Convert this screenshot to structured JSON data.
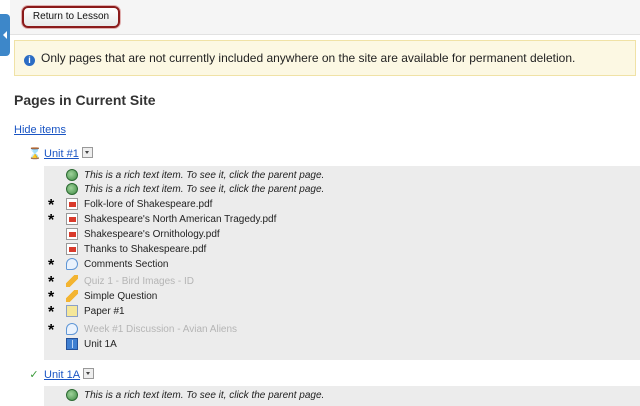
{
  "topbar": {
    "return_label": "Return to Lesson"
  },
  "info": {
    "icon": "info-icon",
    "message": "Only pages that are not currently included anywhere on the site are available for permanent deletion."
  },
  "page": {
    "title": "Pages in Current Site",
    "hide_items": "Hide items"
  },
  "units": [
    {
      "name": "Unit #1",
      "status_icon": "hourglass-icon",
      "status_glyph": "⌛"
    },
    {
      "name": "Unit 1A",
      "status_icon": "checkmark-icon",
      "status_glyph": "✓"
    }
  ],
  "unit1_items": [
    {
      "text": "This is a rich text item. To see it, click the parent page.",
      "icon": "rich-text-icon",
      "star": ""
    },
    {
      "text": "This is a rich text item. To see it, click the parent page.",
      "icon": "rich-text-icon",
      "star": ""
    },
    {
      "text": "Folk-lore of Shakespeare.pdf",
      "icon": "pdf-icon",
      "star": "*"
    },
    {
      "text": "Shakespeare's North American Tragedy.pdf",
      "icon": "pdf-icon",
      "star": "*"
    },
    {
      "text": "Shakespeare's Ornithology.pdf",
      "icon": "pdf-icon",
      "star": ""
    },
    {
      "text": "Thanks to Shakespeare.pdf",
      "icon": "pdf-icon",
      "star": ""
    },
    {
      "text": "Comments Section",
      "icon": "comment-icon",
      "star": "*"
    },
    {
      "text": "Quiz 1 - Bird Images - ID",
      "icon": "pencil-icon",
      "star": "*"
    },
    {
      "text": "Simple Question",
      "icon": "pencil-icon",
      "star": "*"
    },
    {
      "text": "Paper #1",
      "icon": "paper-icon",
      "star": "*"
    },
    {
      "text": "Week #1 Discussion - Avian Aliens",
      "icon": "comment-icon",
      "star": "*"
    },
    {
      "text": "Unit 1A",
      "icon": "book-icon",
      "star": ""
    }
  ],
  "unit2_items": [
    {
      "text": "This is a rich text item. To see it, click the parent page.",
      "icon": "rich-text-icon",
      "star": ""
    }
  ],
  "colors": {
    "link": "#1a55c4",
    "info_bg": "#fcf8e3",
    "panel_bg": "#ececec",
    "highlight": "#8b1a1a"
  }
}
